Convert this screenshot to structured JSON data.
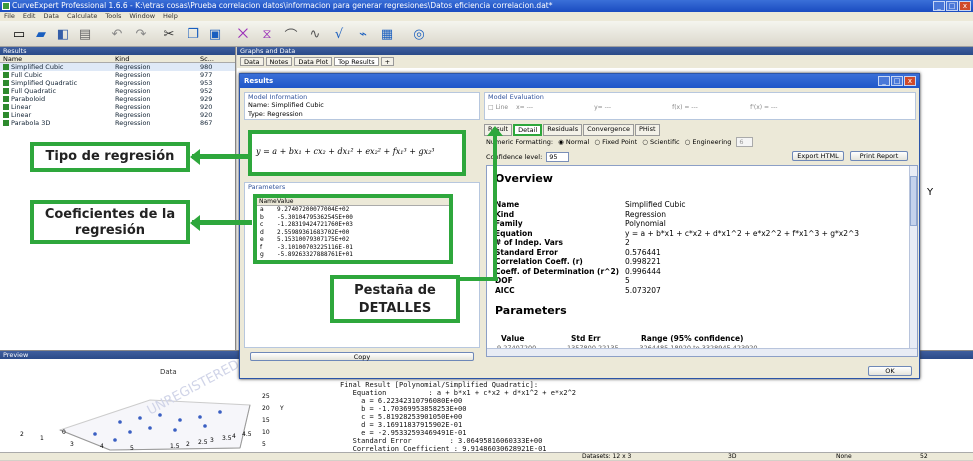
{
  "app": {
    "title": "CurveExpert Professional 1.6.6 - K:\\etras cosas\\Prueba correlacion datos\\informacion para generar regresiones\\Datos eficiencia correlacion.dat*"
  },
  "menu": [
    "File",
    "Edit",
    "Data",
    "Calculate",
    "Tools",
    "Window",
    "Help"
  ],
  "results_panel": {
    "title": "Results",
    "columns": [
      "Name",
      "Kind",
      "Sc..."
    ],
    "rows": [
      {
        "name": "Simplified Cubic",
        "kind": "Regression",
        "score": "980"
      },
      {
        "name": "Full Cubic",
        "kind": "Regression",
        "score": "977"
      },
      {
        "name": "Simplified Quadratic",
        "kind": "Regression",
        "score": "953"
      },
      {
        "name": "Full Quadratic",
        "kind": "Regression",
        "score": "952"
      },
      {
        "name": "Paraboloid",
        "kind": "Regression",
        "score": "929"
      },
      {
        "name": "Linear",
        "kind": "Regression",
        "score": "920"
      },
      {
        "name": "Linear",
        "kind": "Regression",
        "score": "920"
      },
      {
        "name": "Parabola 3D",
        "kind": "Regression",
        "score": "867"
      }
    ]
  },
  "graphs_panel": {
    "title": "Graphs and Data",
    "tabs": [
      "Data",
      "Notes",
      "Data Plot",
      "Top Results",
      "+"
    ]
  },
  "preview_panel": {
    "title": "Preview",
    "plot_label": "Data",
    "axis_label": "Y",
    "watermark": "UNREGISTERED",
    "ticks": [
      "25",
      "20",
      "15",
      "10",
      "5",
      "3",
      "4",
      "5",
      "1.5",
      "2",
      "2.5",
      "3",
      "3.5",
      "4",
      "4.5",
      "0",
      "1",
      "2"
    ],
    "output_lines": [
      "Final Result [Polynomial/Simplified Quadratic]:",
      "   Equation          : a + b*x1 + c*x2 + d*x1^2 + e*x2^2",
      "     a = 6.22342310796080E+00",
      "     b = -1.70369953858253E+00",
      "     c = 5.81928253901050E+00",
      "     d = 3.16911837915902E-01",
      "     e = -2.95332593469491E-01",
      "   Standard Error         : 3.06495816060333E+00",
      "   Correlation Coefficient : 9.91486030628921E-01"
    ]
  },
  "right_side": {
    "axis_y": "Y"
  },
  "dialog": {
    "title": "Results",
    "model_info": {
      "title": "Model Information",
      "name_label": "Name: Simplified Cubic",
      "type_label": "Type: Regression",
      "equation": "y = a + bx₁ + cx₂ + dx₁² + ex₂² + fx₁³ + gx₂³"
    },
    "parameters": {
      "title": "Parameters",
      "columns": [
        "Name",
        "Value"
      ],
      "rows": [
        {
          "name": "a",
          "value": "9.27407200077004E+02"
        },
        {
          "name": "b",
          "value": "-5.30104795362545E+00"
        },
        {
          "name": "c",
          "value": "-1.28319424721760E+03"
        },
        {
          "name": "d",
          "value": "2.55989361683702E+00"
        },
        {
          "name": "e",
          "value": "5.15310079307175E+02"
        },
        {
          "name": "f",
          "value": "-3.10100703225116E-01"
        },
        {
          "name": "g",
          "value": "-5.89263327888761E+01"
        }
      ],
      "copy_label": "Copy"
    },
    "model_eval": {
      "title": "Model Evaluation",
      "line_label": "Line",
      "xeq": "x= ---",
      "yeq": "y= ---",
      "fx1": "f(x) = ---",
      "fx2": "f'(x) = ---"
    },
    "tabs": [
      "Result",
      "Detail",
      "Residuals",
      "Convergence",
      "PHist"
    ],
    "formatting": {
      "label": "Numeric Formatting:",
      "options": [
        "Normal",
        "Fixed Point",
        "Scientific",
        "Engineering"
      ],
      "digits_value": "6"
    },
    "confidence": {
      "label": "Confidence level:",
      "value": "95"
    },
    "export_html": "Export HTML",
    "print_report": "Print Report",
    "report": {
      "overview_title": "Overview",
      "rows": [
        {
          "k": "Name",
          "v": "Simplified Cubic"
        },
        {
          "k": "Kind",
          "v": "Regression"
        },
        {
          "k": "Family",
          "v": "Polynomial"
        },
        {
          "k": "Equation",
          "v": "y = a + b*x1 + c*x2 + d*x1^2 + e*x2^2 + f*x1^3 + g*x2^3"
        },
        {
          "k": "# of Indep. Vars",
          "v": "2"
        },
        {
          "k": "Standard Error",
          "v": "0.576441"
        },
        {
          "k": "Correlation Coeff. (r)",
          "v": "0.998221"
        },
        {
          "k": "Coeff. of Determination (r^2)",
          "v": "0.996444"
        },
        {
          "k": "DOF",
          "v": "5"
        },
        {
          "k": "AICC",
          "v": "5.073207"
        }
      ],
      "params_title": "Parameters",
      "param_cols": [
        "Value",
        "Std Err",
        "Range (95% confidence)"
      ],
      "param_partial": [
        "9.27407200",
        "1357800.22135",
        "-3264485.18920 to 3328945.423920"
      ]
    },
    "ok_label": "OK"
  },
  "annotations": {
    "tipo": "Tipo de regresión",
    "coef": "Coeficientes de la regresión",
    "pestana": "Pestaña de DETALLES"
  },
  "statusbar": {
    "datasets": "Datasets: 12 x 3",
    "mode": "3D",
    "sel": "None",
    "extra": "52"
  },
  "colors": {
    "accent": "#2ea73c",
    "title_blue": "#1e56c8"
  }
}
